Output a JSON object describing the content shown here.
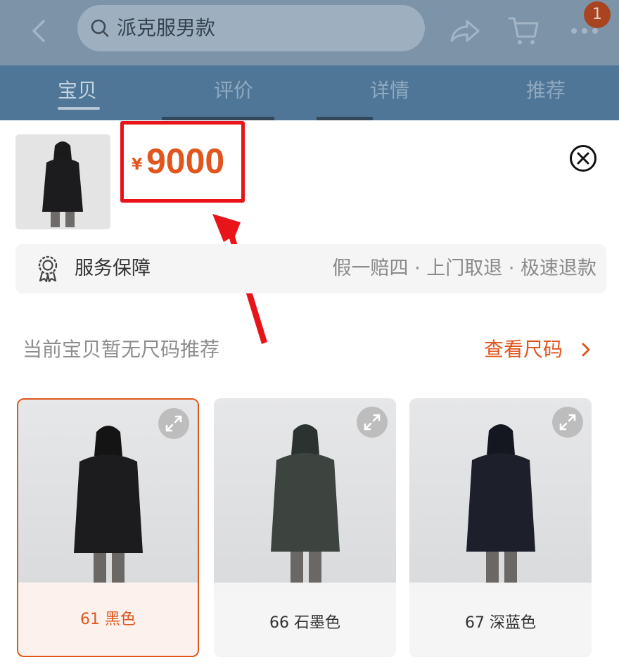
{
  "header": {
    "search_text": "派克服男款",
    "cart_badge": "1",
    "tabs": [
      {
        "label": "宝贝",
        "active": true
      },
      {
        "label": "评价",
        "active": false
      },
      {
        "label": "详情",
        "active": false
      },
      {
        "label": "推荐",
        "active": false
      }
    ]
  },
  "product": {
    "currency_symbol": "¥",
    "price": "9000"
  },
  "service": {
    "title": "服务保障",
    "description": "假一赔四 · 上门取退 · 极速退款"
  },
  "size": {
    "hint": "当前宝贝暂无尺码推荐",
    "link": "查看尺码"
  },
  "skus": [
    {
      "label": "61 黑色",
      "selected": true,
      "coat_color": "#1c1c1e"
    },
    {
      "label": "66 石墨色",
      "selected": false,
      "coat_color": "#3d4440"
    },
    {
      "label": "67 深蓝色",
      "selected": false,
      "coat_color": "#1d1f2a"
    }
  ],
  "colors": {
    "accent": "#e0561e",
    "highlight_box": "#e8141a",
    "header_dim": "#7c93a8",
    "tabbar_dim": "#4f7697"
  }
}
